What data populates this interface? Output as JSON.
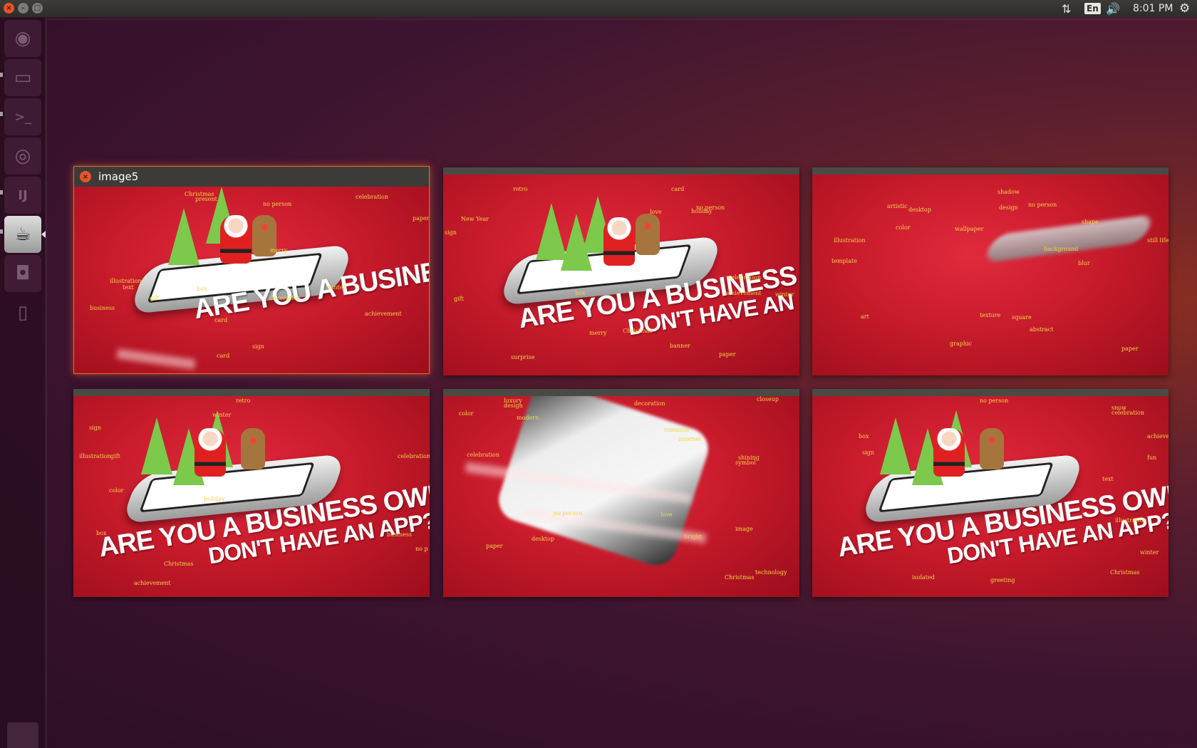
{
  "panel": {
    "window_controls": {
      "close": "×",
      "minimize": "–",
      "maximize": "□"
    },
    "indicators": {
      "network": "⇅",
      "language": "En",
      "sound": "🔊",
      "clock": "8:01 PM",
      "system": "⚙"
    }
  },
  "launcher": {
    "items": [
      {
        "name": "ubuntu-dash",
        "icon": "◉"
      },
      {
        "name": "file-manager",
        "icon": "▭"
      },
      {
        "name": "terminal",
        "icon": ">_"
      },
      {
        "name": "chrome-browser",
        "icon": "◎"
      },
      {
        "name": "intellij",
        "icon": "IJ"
      },
      {
        "name": "java-app",
        "icon": "☕"
      },
      {
        "name": "screenshot",
        "icon": "◘"
      },
      {
        "name": "device",
        "icon": "▯"
      }
    ],
    "trash_icon": "trash-icon"
  },
  "spread": {
    "focused_title": "image5",
    "headline": {
      "line1": "ARE YOU A BUSINESS OWNER?",
      "line2": "DON'T HAVE AN APP?"
    },
    "windows": [
      {
        "tags": [
          "Christmas",
          "present",
          "no person",
          "celebration",
          "paper",
          "merry",
          "illustration",
          "text",
          "business",
          "gift",
          "box",
          "decoration",
          "winter",
          "achievement",
          "card",
          "sign",
          "card"
        ]
      },
      {
        "tags": [
          "retro",
          "card",
          "love",
          "no person",
          "holiday",
          "New Year",
          "sign",
          "celebration",
          "gift",
          "box",
          "achievement",
          "winter",
          "merry",
          "Christmas",
          "banner",
          "paper",
          "surprise"
        ]
      },
      {
        "tags": [
          "shadow",
          "artistic",
          "desktop",
          "design",
          "no person",
          "color",
          "wallpaper",
          "shape",
          "illustration",
          "background",
          "still life",
          "template",
          "blur",
          "art",
          "texture",
          "square",
          "abstract",
          "graphic",
          "paper"
        ]
      },
      {
        "tags": [
          "retro",
          "sign",
          "winter",
          "illustration",
          "gift",
          "celebration",
          "color",
          "holiday",
          "box",
          "business",
          "no p",
          "Christmas",
          "achievement"
        ]
      },
      {
        "tags": [
          "luxury",
          "design",
          "decoration",
          "closeup",
          "color",
          "modern",
          "romance",
          "celebration",
          "internet",
          "shining",
          "symbol",
          "no person",
          "love",
          "image",
          "desktop",
          "bright",
          "paper",
          "Christmas",
          "technology"
        ]
      },
      {
        "tags": [
          "no person",
          "snow",
          "celebration",
          "box",
          "sign",
          "achievement",
          "fun",
          "text",
          "illustration",
          "winter",
          "Christmas",
          "isolated",
          "greeting"
        ]
      }
    ]
  }
}
